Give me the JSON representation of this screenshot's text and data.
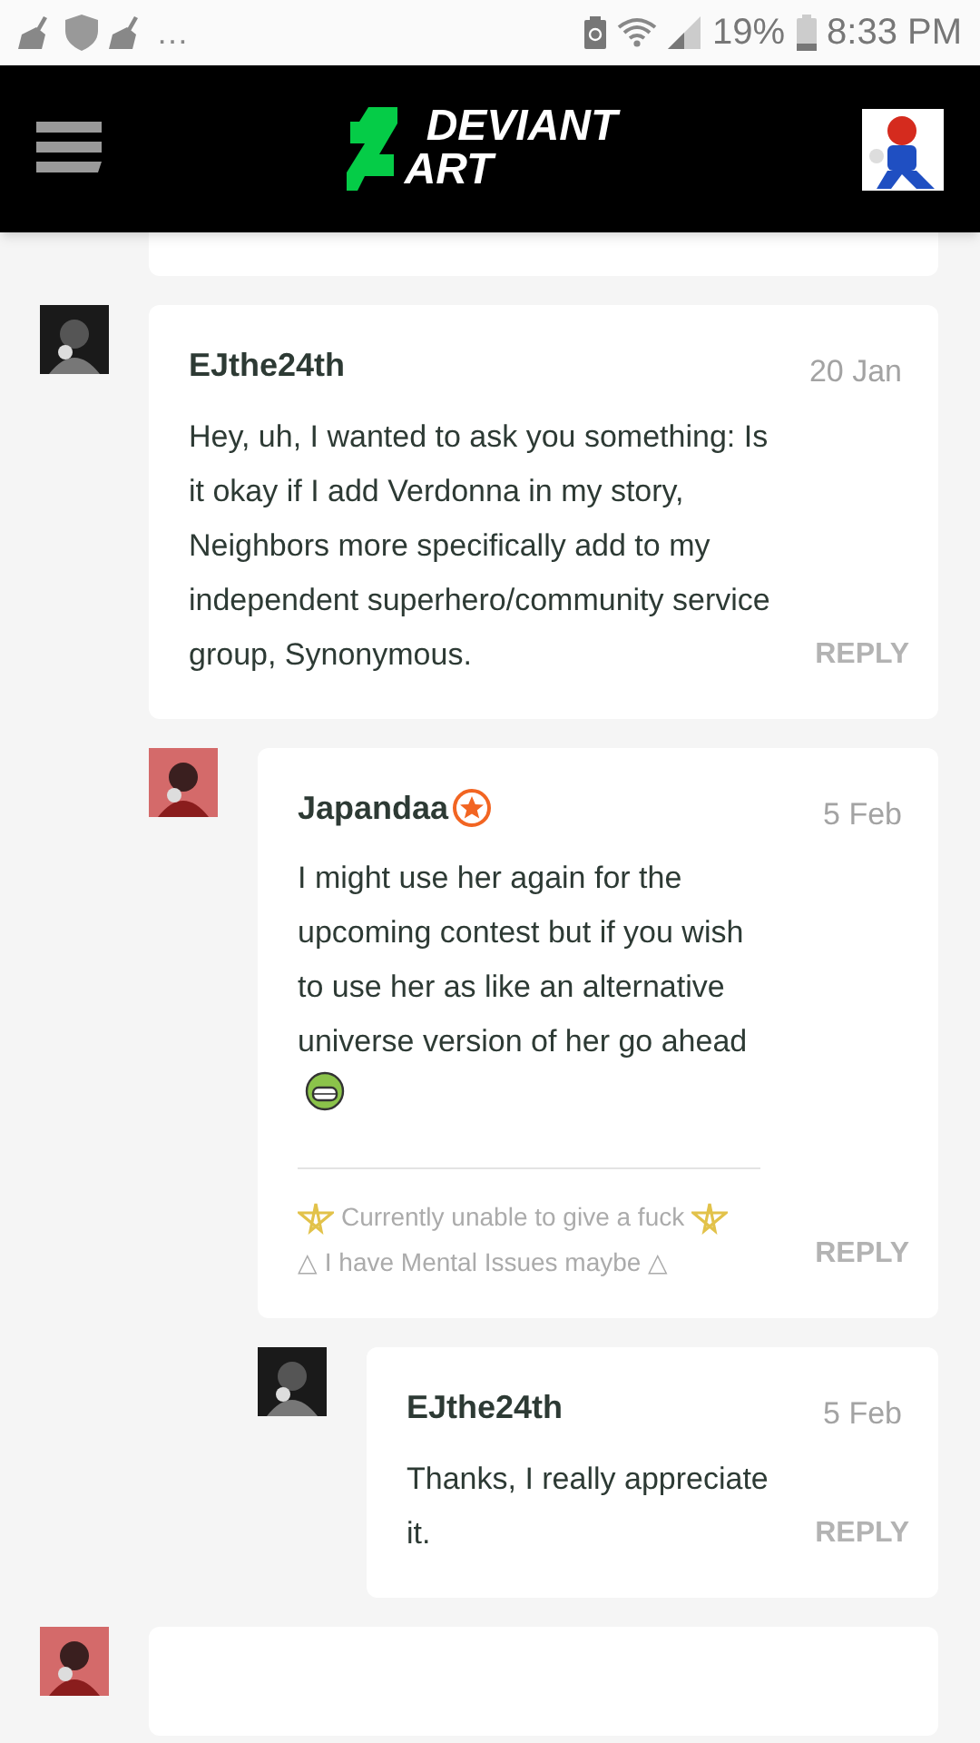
{
  "status_bar": {
    "overflow": "…",
    "battery": "19%",
    "time": "8:33 PM"
  },
  "header": {
    "logo_line_1": "DEVIANT",
    "logo_line_2": "ART"
  },
  "comments": [
    {
      "author": "EJthe24th",
      "badge": false,
      "date": "20 Jan",
      "body": "Hey, uh, I wanted to ask you something: Is it okay if I add Verdonna in my story, Neighbors more specifically add to my independent superhero/community service group, Synonymous.",
      "emoji": false,
      "reply": "REPLY",
      "children": [
        {
          "author": "Japandaa",
          "badge": true,
          "date": "5 Feb",
          "body": "I might use her again for the upcoming contest but if you wish to use her as like an alternative universe version of her go ahead",
          "emoji": true,
          "reply": "REPLY",
          "signature": [
            {
              "kind": "stars",
              "text": "Currently unable to give a fuck"
            },
            {
              "kind": "plain",
              "text": "△ I have Mental Issues maybe △"
            }
          ],
          "children": [
            {
              "author": "EJthe24th",
              "badge": false,
              "date": "5 Feb",
              "body": "Thanks, I really appreciate it.",
              "emoji": false,
              "reply": "REPLY"
            }
          ]
        }
      ]
    }
  ]
}
